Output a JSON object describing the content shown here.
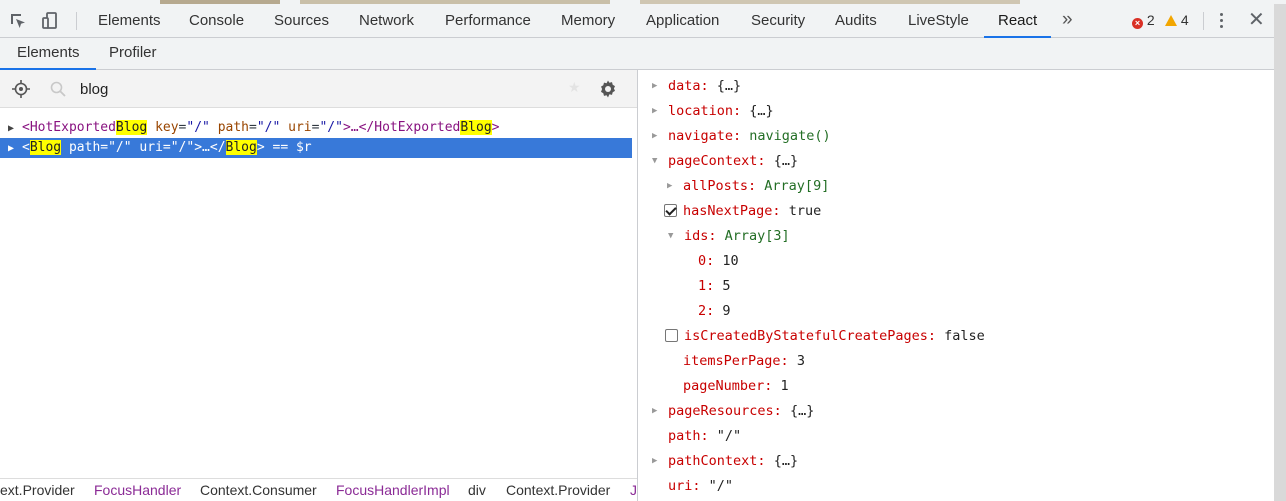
{
  "devtools": {
    "tabs": [
      "Elements",
      "Console",
      "Sources",
      "Network",
      "Performance",
      "Memory",
      "Application",
      "Security",
      "Audits",
      "LiveStyle",
      "React"
    ],
    "active_tab": "React",
    "more_tabs": "»",
    "error_count": "2",
    "warning_count": "4",
    "close": "✕",
    "icons": {
      "inspect": "inspect-element-icon",
      "device": "device-toolbar-icon",
      "error": "error-icon",
      "warning": "warning-icon",
      "menu": "kebab-menu-icon",
      "close": "close-icon"
    }
  },
  "react": {
    "subtabs": [
      "Elements",
      "Profiler"
    ],
    "active_subtab": "Elements",
    "search": {
      "value": "blog",
      "placeholder": ""
    },
    "tree": [
      {
        "open": "<",
        "name_pre": "HotExported",
        "name_hl": "Blog",
        "attrs": [
          {
            "name": "key",
            "value": "\"/\""
          },
          {
            "name": "path",
            "value": "\"/\""
          },
          {
            "name": "uri",
            "value": "\"/\""
          }
        ],
        "mid": ">…</",
        "close_pre": "HotExported",
        "close_hl": "Blog",
        "end": ">",
        "selected": false
      },
      {
        "open": "<",
        "name_pre": "",
        "name_hl": "Blog",
        "attrs": [
          {
            "name": "path",
            "value": "\"/\""
          },
          {
            "name": "uri",
            "value": "\"/\""
          }
        ],
        "mid": ">…</",
        "close_pre": "",
        "close_hl": "Blog",
        "end": ">",
        "suffix": "== $r",
        "selected": true
      }
    ],
    "breadcrumbs": [
      {
        "label": "ext.Provider",
        "style": "dark"
      },
      {
        "label": "FocusHandler",
        "style": "purple"
      },
      {
        "label": "Context.Consumer",
        "style": "dark"
      },
      {
        "label": "FocusHandlerImpl",
        "style": "purple"
      },
      {
        "label": "div",
        "style": "dark"
      },
      {
        "label": "Context.Provider",
        "style": "dark"
      },
      {
        "label": "J",
        "style": "purple"
      }
    ],
    "props": {
      "data": {
        "key": "data:",
        "value": "{…}"
      },
      "location": {
        "key": "location:",
        "value": "{…}"
      },
      "navigate": {
        "key": "navigate:",
        "value": "navigate()"
      },
      "pageContext": {
        "key": "pageContext:",
        "value": "{…}"
      },
      "allPosts": {
        "key": "allPosts:",
        "value": "Array[9]"
      },
      "hasNextPage": {
        "key": "hasNextPage:",
        "value": "true",
        "checked": true
      },
      "ids": {
        "key": "ids:",
        "value": "Array[3]"
      },
      "ids_0": {
        "key": "0:",
        "value": "10"
      },
      "ids_1": {
        "key": "1:",
        "value": "5"
      },
      "ids_2": {
        "key": "2:",
        "value": "9"
      },
      "isCreated": {
        "key": "isCreatedByStatefulCreatePages:",
        "value": "false",
        "checked": false
      },
      "itemsPerPage": {
        "key": "itemsPerPage:",
        "value": "3"
      },
      "pageNumber": {
        "key": "pageNumber:",
        "value": "1"
      },
      "pageResources": {
        "key": "pageResources:",
        "value": "{…}"
      },
      "path": {
        "key": "path:",
        "value": "\"/\""
      },
      "pathContext": {
        "key": "pathContext:",
        "value": "{…}"
      },
      "uri": {
        "key": "uri:",
        "value": "\"/\""
      }
    }
  }
}
